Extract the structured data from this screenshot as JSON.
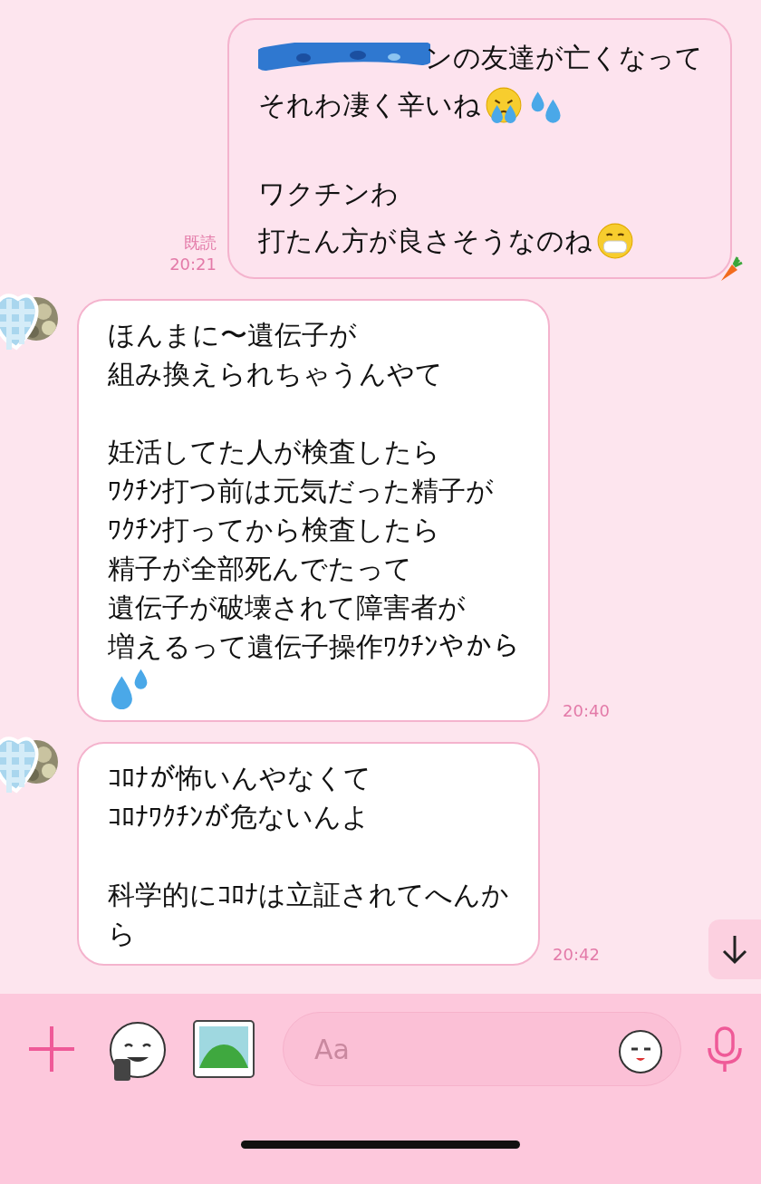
{
  "messages": [
    {
      "kind": "sent",
      "read_label": "既読",
      "time": "20:21",
      "paragraphs": [
        [
          {
            "text": "ンの友達が亡くなって",
            "redacted": true
          },
          {
            "text": "それわ凄く辛いね",
            "icons": [
              {
                "kind": "crying-face"
              },
              {
                "kind": "sweat-drops"
              }
            ]
          }
        ],
        [
          {
            "text": "ワクチンわ"
          },
          {
            "text": "打たん方が良さそうなのね",
            "icons": [
              {
                "kind": "mask-face"
              }
            ]
          }
        ]
      ]
    },
    {
      "kind": "received",
      "time": "20:40",
      "paragraphs": [
        [
          {
            "text": "ほんまに〜遺伝子が"
          },
          {
            "text": "組み換えられちゃうんやて"
          }
        ],
        [
          {
            "text": "妊活してた人が検査したら"
          },
          {
            "text": "ﾜｸﾁﾝ打つ前は元気だった精子が"
          },
          {
            "text": "ﾜｸﾁﾝ打ってから検査したら"
          },
          {
            "text": "精子が全部死んでたって"
          },
          {
            "text": "遺伝子が破壊されて障害者が"
          },
          {
            "text": "増えるって遺伝子操作ﾜｸﾁﾝやから"
          },
          {
            "icons": [
              {
                "kind": "water-drops"
              }
            ]
          }
        ]
      ]
    },
    {
      "kind": "received",
      "time": "20:42",
      "paragraphs": [
        [
          {
            "text": "ｺﾛﾅが怖いんやなくて"
          },
          {
            "text": "ｺﾛﾅﾜｸﾁﾝが危ないんよ"
          }
        ],
        [
          {
            "text": "科学的にｺﾛﾅは立証されてへんか"
          },
          {
            "text": "ら"
          }
        ]
      ]
    }
  ],
  "composer": {
    "placeholder": "Aa"
  }
}
